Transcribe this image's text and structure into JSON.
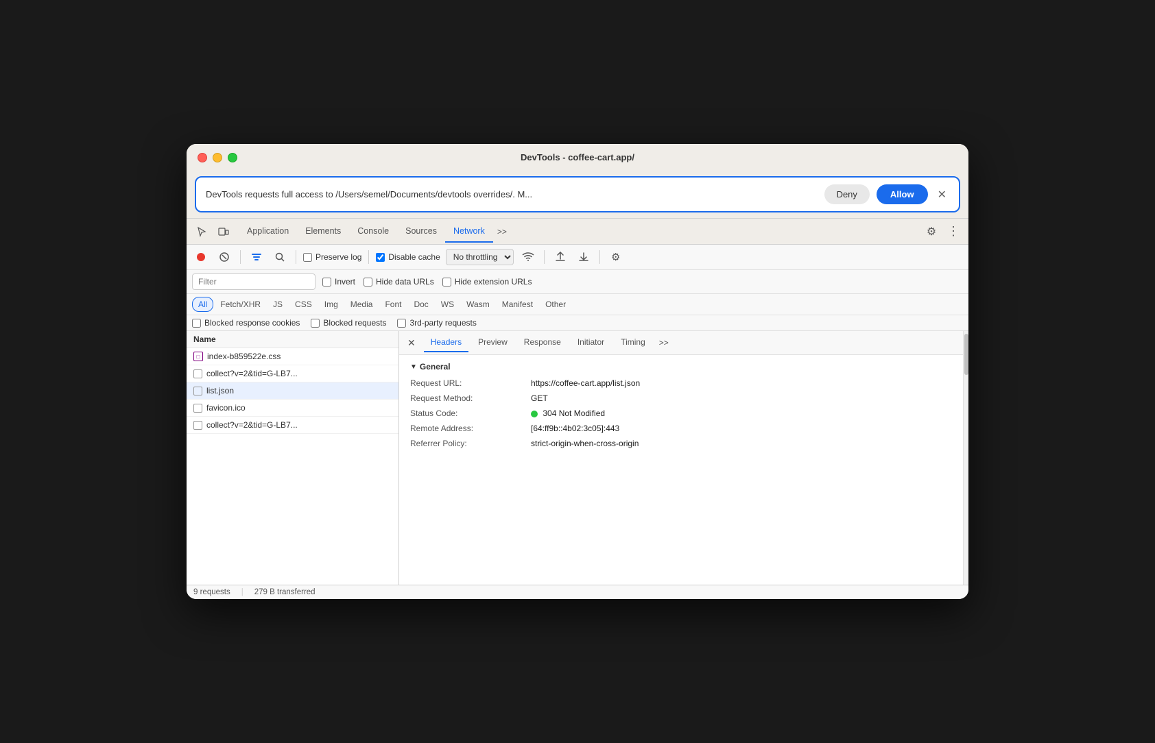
{
  "window": {
    "title": "DevTools - coffee-cart.app/"
  },
  "permission_bar": {
    "text": "DevTools requests full access to /Users/semel/Documents/devtools overrides/. M...",
    "deny_label": "Deny",
    "allow_label": "Allow"
  },
  "tabs": {
    "items": [
      {
        "label": "Application",
        "active": false
      },
      {
        "label": "Elements",
        "active": false
      },
      {
        "label": "Console",
        "active": false
      },
      {
        "label": "Sources",
        "active": false
      },
      {
        "label": "Network",
        "active": true
      }
    ],
    "more_label": ">>",
    "settings_label": "⚙",
    "menu_label": "⋮"
  },
  "toolbar": {
    "preserve_log_label": "Preserve log",
    "disable_cache_label": "Disable cache",
    "no_throttling_label": "No throttling"
  },
  "filter": {
    "placeholder": "Filter",
    "invert_label": "Invert",
    "hide_data_urls_label": "Hide data URLs",
    "hide_extension_urls_label": "Hide extension URLs"
  },
  "type_filters": [
    "All",
    "Fetch/XHR",
    "JS",
    "CSS",
    "Img",
    "Media",
    "Font",
    "Doc",
    "WS",
    "Wasm",
    "Manifest",
    "Other"
  ],
  "blocked_bar": {
    "blocked_cookies_label": "Blocked response cookies",
    "blocked_requests_label": "Blocked requests",
    "third_party_label": "3rd-party requests"
  },
  "file_list": {
    "header": "Name",
    "items": [
      {
        "name": "index-b859522e.css",
        "icon": "css",
        "selected": false
      },
      {
        "name": "collect?v=2&tid=G-LB7...",
        "icon": "checkbox",
        "selected": false
      },
      {
        "name": "list.json",
        "icon": "checkbox",
        "selected": true
      },
      {
        "name": "favicon.ico",
        "icon": "checkbox",
        "selected": false
      },
      {
        "name": "collect?v=2&tid=G-LB7...",
        "icon": "checkbox",
        "selected": false
      }
    ]
  },
  "detail_panel": {
    "tabs": [
      {
        "label": "Headers",
        "active": true
      },
      {
        "label": "Preview",
        "active": false
      },
      {
        "label": "Response",
        "active": false
      },
      {
        "label": "Initiator",
        "active": false
      },
      {
        "label": "Timing",
        "active": false
      }
    ],
    "more_label": ">>",
    "section_title": "General",
    "rows": [
      {
        "key": "Request URL:",
        "val": "https://coffee-cart.app/list.json"
      },
      {
        "key": "Request Method:",
        "val": "GET"
      },
      {
        "key": "Status Code:",
        "val": "304 Not Modified",
        "status_dot": true
      },
      {
        "key": "Remote Address:",
        "val": "[64:ff9b::4b02:3c05]:443"
      },
      {
        "key": "Referrer Policy:",
        "val": "strict-origin-when-cross-origin"
      }
    ]
  },
  "status_bar": {
    "requests": "9 requests",
    "transferred": "279 B transferred"
  }
}
